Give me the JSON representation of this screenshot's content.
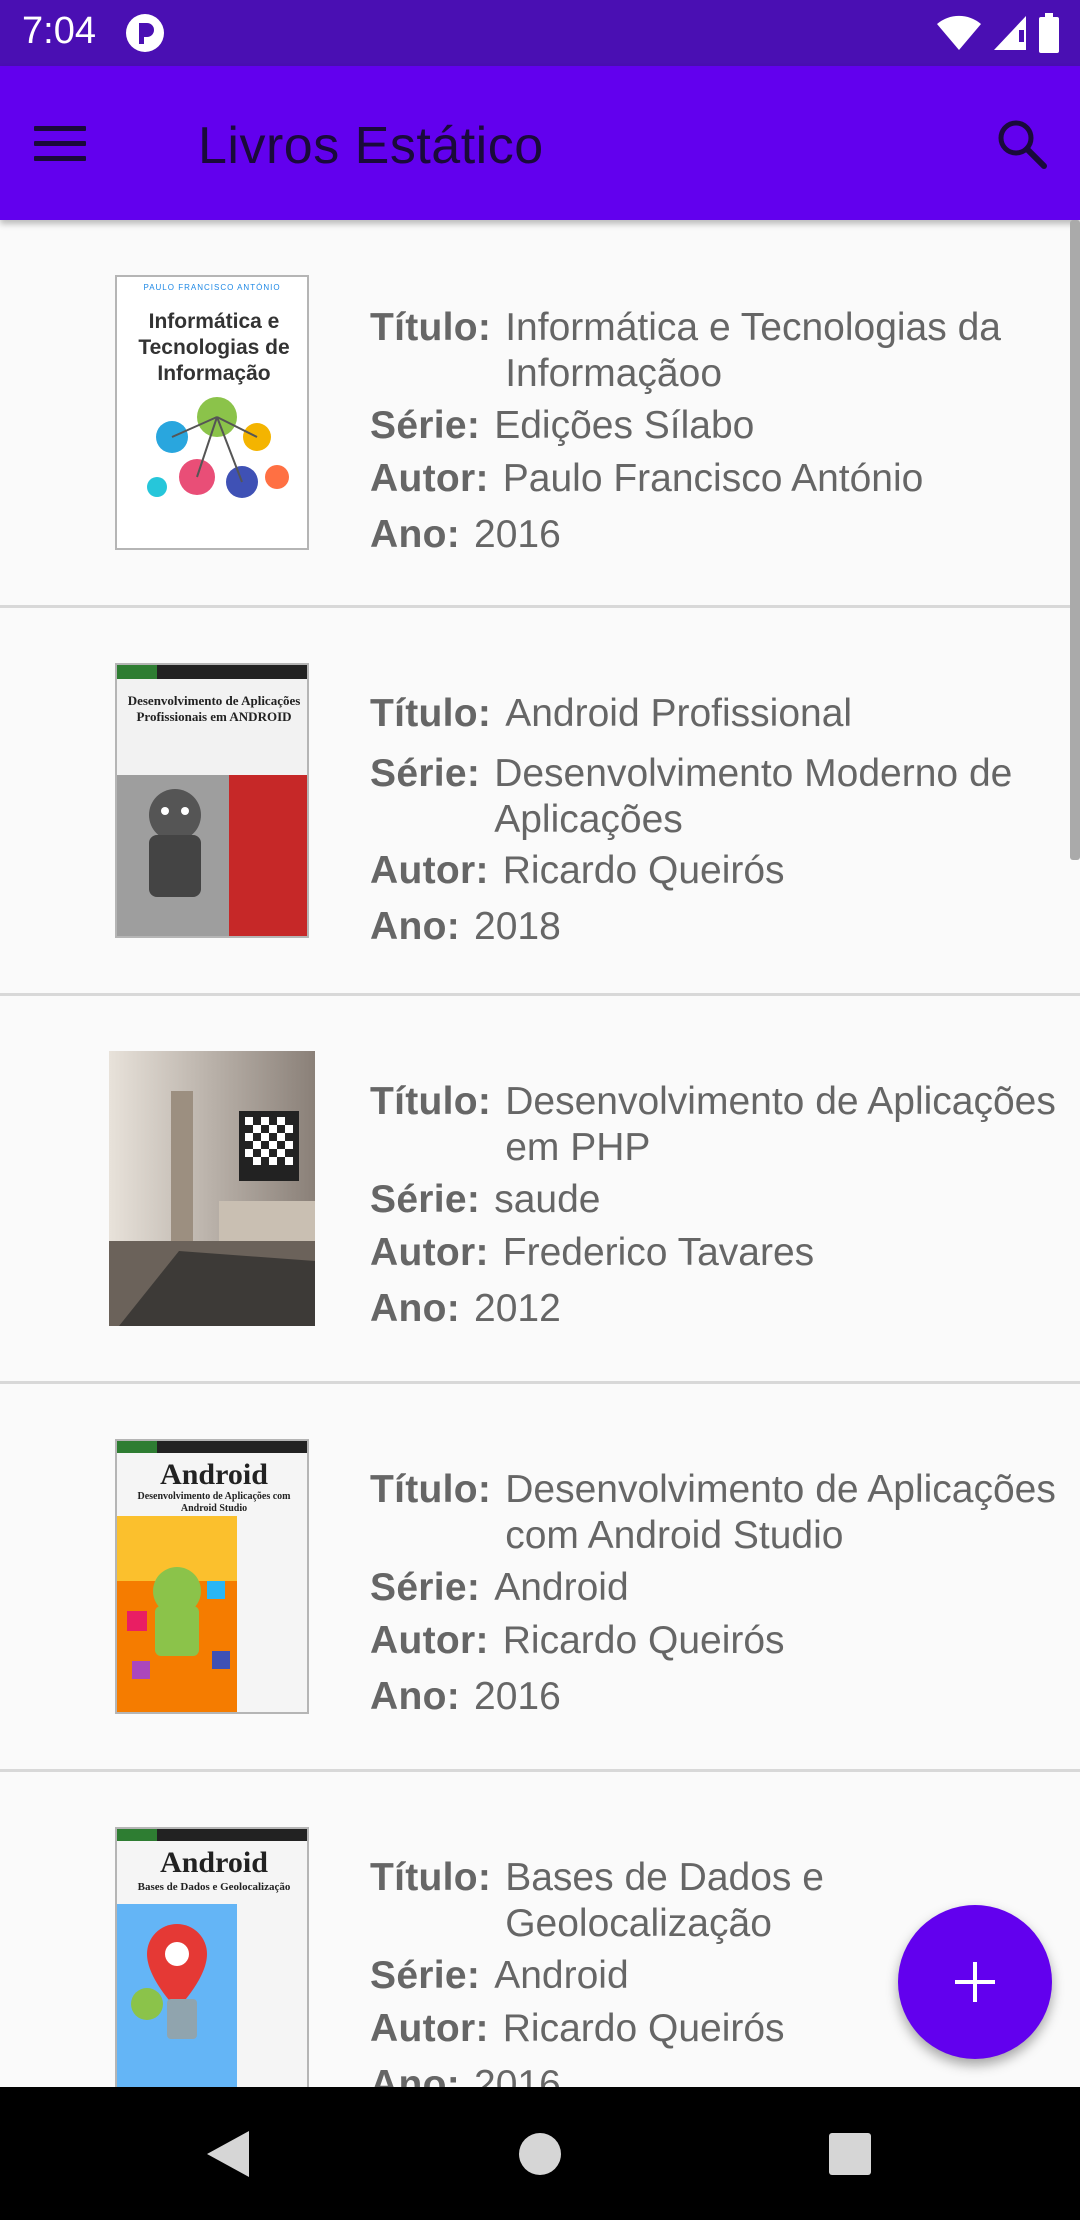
{
  "status": {
    "time": "7:04"
  },
  "appbar": {
    "title": "Livros Estático"
  },
  "labels": {
    "titulo": "Título:",
    "serie": "Série:",
    "autor": "Autor:",
    "ano": "Ano:"
  },
  "books": [
    {
      "titulo": "Informática e Tecnologias da Informaçãoo",
      "serie": "Edições Sílabo",
      "autor": "Paulo Francisco António",
      "ano": "2016",
      "cover_text": {
        "top": "PAULO FRANCISCO ANTÓNIO",
        "title": "Informática e Tecnologias de Informação"
      }
    },
    {
      "titulo": "Android Profissional",
      "serie": "Desenvolvimento Moderno de Aplicações",
      "autor": "Ricardo Queirós",
      "ano": "2018",
      "cover_text": {
        "title": "Desenvolvimento de Aplicações Profissionais em ANDROID"
      }
    },
    {
      "titulo": "Desenvolvimento de Aplicações em PHP",
      "serie": "saude",
      "autor": "Frederico Tavares",
      "ano": "2012"
    },
    {
      "titulo": "Desenvolvimento de Aplicações com Android Studio",
      "serie": "Android",
      "autor": "Ricardo Queirós",
      "ano": "2016",
      "cover_text": {
        "title": "Android",
        "subtitle": "Desenvolvimento de Aplicações com Android Studio"
      }
    },
    {
      "titulo": "Bases de Dados e Geolocalização",
      "serie": "Android",
      "autor": "Ricardo Queirós",
      "ano": "2016",
      "cover_text": {
        "title": "Android",
        "subtitle": "Bases de Dados e Geolocalização"
      }
    }
  ],
  "colors": {
    "primary": "#6200ee",
    "status_bar": "#4a0fb3",
    "title_text": "#1a0a3a",
    "body_text": "#666666"
  },
  "icons": {
    "menu": "menu-icon",
    "search": "search-icon",
    "add": "add-icon",
    "back": "back-icon",
    "home": "home-icon",
    "recents": "recents-icon"
  }
}
